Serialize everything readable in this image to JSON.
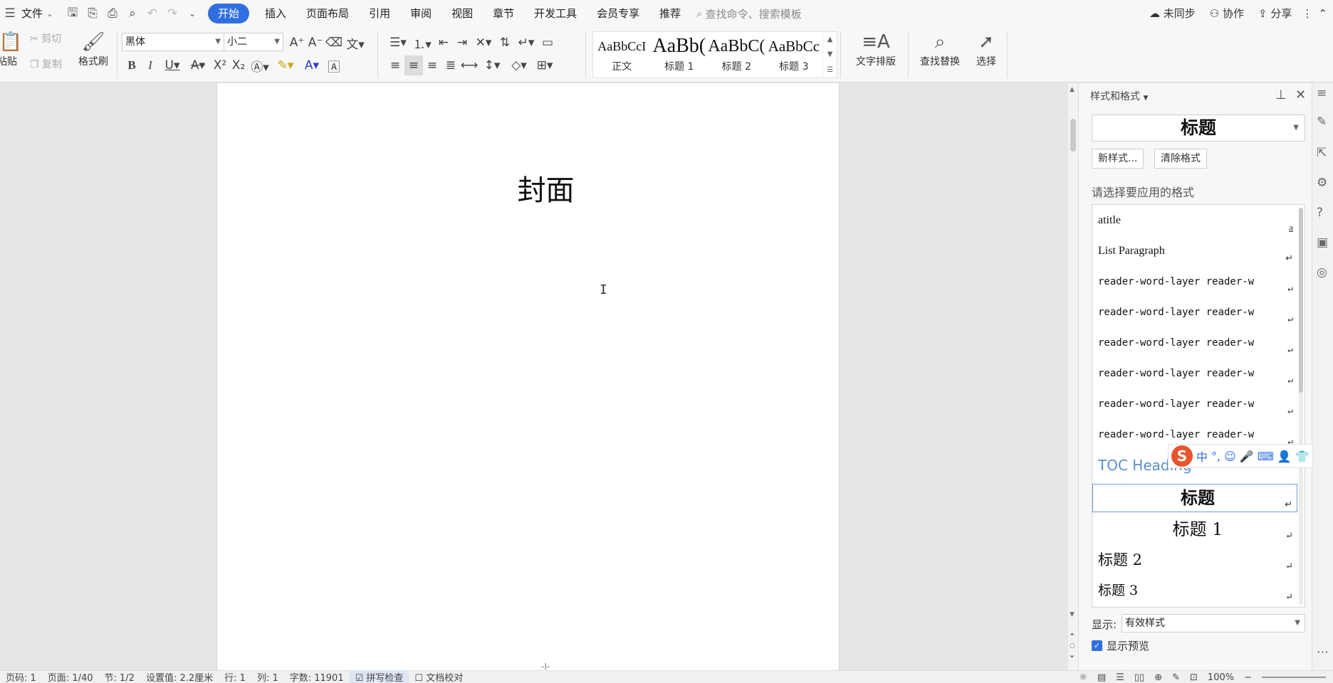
{
  "menubar": {
    "menu_label": "文件",
    "tabs": [
      {
        "label": "开始",
        "active": true
      },
      {
        "label": "插入"
      },
      {
        "label": "页面布局"
      },
      {
        "label": "引用"
      },
      {
        "label": "审阅"
      },
      {
        "label": "视图"
      },
      {
        "label": "章节"
      },
      {
        "label": "开发工具"
      },
      {
        "label": "会员专享"
      },
      {
        "label": "推荐"
      }
    ],
    "search_placeholder": "查找命令、搜索模板",
    "sync_label": "未同步",
    "collab_label": "协作",
    "share_label": "分享"
  },
  "ribbon": {
    "paste_label": "粘贴",
    "cut_label": "剪切",
    "copy_label": "复制",
    "format_painter_label": "格式刷",
    "font_name": "黑体",
    "font_size": "小二",
    "styles": [
      {
        "preview": "AaBbCcI",
        "name": "正文",
        "size": 18
      },
      {
        "preview": "AaBb(",
        "name": "标题 1",
        "size": 28
      },
      {
        "preview": "AaBbC(",
        "name": "标题 2",
        "size": 24
      },
      {
        "preview": "AaBbCc",
        "name": "标题 3",
        "size": 21
      }
    ],
    "text_layout_label": "文字排版",
    "find_replace_label": "查找替换",
    "select_label": "选择"
  },
  "document": {
    "cover_title": "封面",
    "page_marker": "-I-"
  },
  "styles_pane": {
    "title": "样式和格式",
    "current_style": "标题",
    "new_style_label": "新样式...",
    "clear_format_label": "清除格式",
    "choose_label": "请选择要应用的格式",
    "items": [
      {
        "name": "atitle",
        "mark": "a"
      },
      {
        "name": "List Paragraph",
        "mark": "↵"
      },
      {
        "name": "reader-word-layer reader-w",
        "mark": "↵"
      },
      {
        "name": "reader-word-layer reader-w",
        "mark": "↵"
      },
      {
        "name": "reader-word-layer reader-w",
        "mark": "↵"
      },
      {
        "name": "reader-word-layer reader-w",
        "mark": "↵"
      },
      {
        "name": "reader-word-layer reader-w",
        "mark": "↵"
      },
      {
        "name": "reader-word-layer reader-w",
        "mark": "↵"
      },
      {
        "name": "TOC Heading",
        "mark": ""
      },
      {
        "name": "标题",
        "mark": "↵",
        "selected": true
      },
      {
        "name": "标题  1",
        "mark": "↵"
      },
      {
        "name": "标题  2",
        "mark": "↵"
      },
      {
        "name": "标题  3",
        "mark": "↵"
      }
    ],
    "show_label": "显示:",
    "show_value": "有效样式",
    "preview_label": "显示预览",
    "preview_checked": true
  },
  "ime": {
    "mode": "中"
  },
  "status": {
    "items": [
      "页码: 1",
      "页面: 1/40",
      "节: 1/2",
      "设置值: 2.2厘米",
      "行: 1",
      "列: 1",
      "字数: 11901",
      "拼写检查",
      "文档校对"
    ],
    "zoom": "100%"
  },
  "colors": {
    "accent": "#2f6fe0",
    "toc_heading": "#5b8fcf",
    "ime_logo": "#e8552d"
  }
}
